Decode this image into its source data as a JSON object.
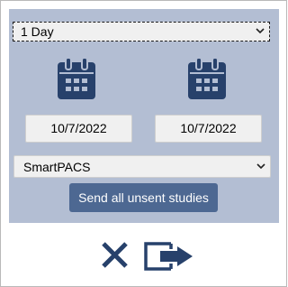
{
  "period": {
    "selected": "1 Day"
  },
  "dates": {
    "from": "10/7/2022",
    "to": "10/7/2022"
  },
  "destination": {
    "selected": "SmartPACS"
  },
  "actions": {
    "send_label": "Send all unsent studies"
  },
  "icons": {
    "from_calendar": "calendar-icon",
    "to_calendar": "calendar-icon",
    "close": "close-icon",
    "export": "export-icon"
  },
  "colors": {
    "panel": "#b3bed3",
    "accent": "#4d6892",
    "icon": "#27416b"
  }
}
